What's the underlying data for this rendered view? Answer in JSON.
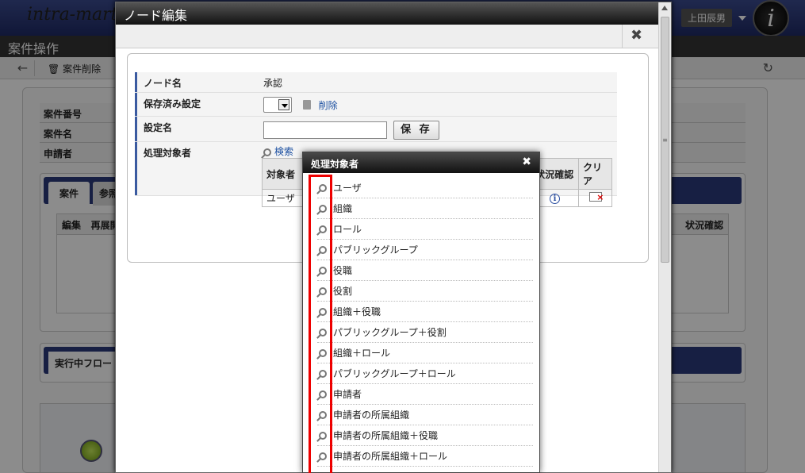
{
  "app": {
    "logo_text": "intra-mart",
    "user_name": "上田辰男",
    "page_title": "案件操作",
    "toolbar": {
      "delete_label": "案件削除"
    },
    "info_rows": [
      "案件番号",
      "案件名",
      "申請者"
    ],
    "tabs": [
      "案件",
      "参照"
    ],
    "grid_headers": {
      "edit": "編集",
      "redeploy": "再展開",
      "status": "状況確認"
    },
    "flow_tab": "実行中フロー"
  },
  "dialog": {
    "title": "ノード編集",
    "fields": {
      "node_name_label": "ノード名",
      "node_name_value": "承認",
      "saved_settings_label": "保存済み設定",
      "delete_link": "削除",
      "setting_name_label": "設定名",
      "setting_name_value": "",
      "save_button": "保 存",
      "target_label": "処理対象者",
      "search_link": "検索"
    },
    "target_table": {
      "headers": {
        "target": "対象者",
        "status": "状況確認",
        "clear": "クリア"
      },
      "rows": [
        {
          "target": "ユーザ"
        }
      ]
    }
  },
  "popup": {
    "title": "処理対象者",
    "items": [
      "ユーザ",
      "組織",
      "ロール",
      "パブリックグループ",
      "役職",
      "役割",
      "組織＋役職",
      "パブリックグループ＋役割",
      "組織＋ロール",
      "パブリックグループ＋ロール",
      "申請者",
      "申請者の所属組織",
      "申請者の所属組織＋役職",
      "申請者の所属組織＋ロール"
    ]
  },
  "colors": {
    "highlight": "#e00000",
    "link": "#1a4ea0",
    "header_bar": "#2a3a7a"
  }
}
